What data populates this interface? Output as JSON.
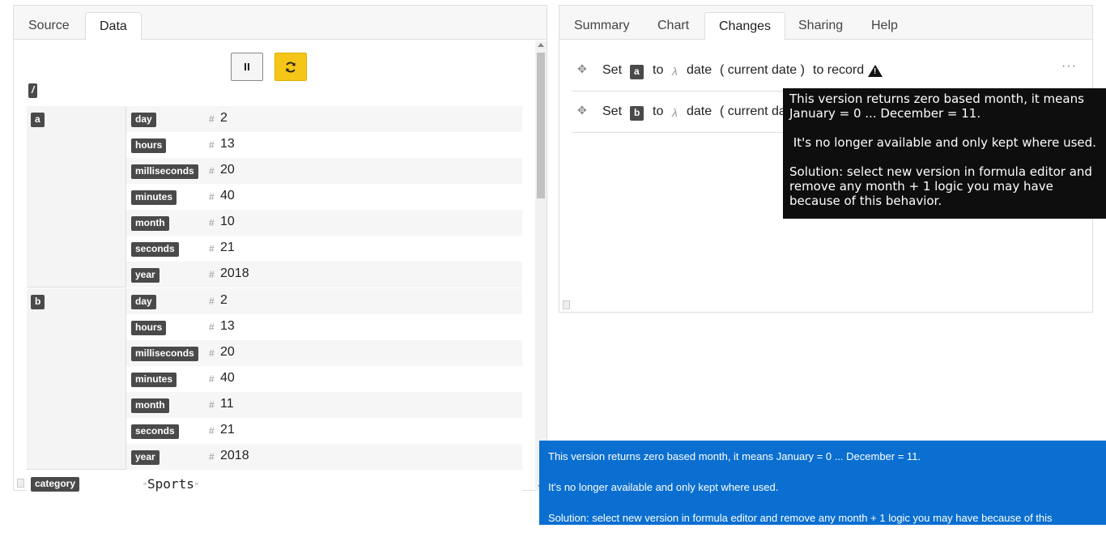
{
  "left_tabs": [
    "Source",
    "Data"
  ],
  "right_tabs": [
    "Summary",
    "Chart",
    "Changes",
    "Sharing",
    "Help"
  ],
  "data_view": {
    "root_label": "/",
    "group_a": {
      "key": "a",
      "rows": [
        {
          "key": "day",
          "value": "2"
        },
        {
          "key": "hours",
          "value": "13"
        },
        {
          "key": "milliseconds",
          "value": "20"
        },
        {
          "key": "minutes",
          "value": "40"
        },
        {
          "key": "month",
          "value": "10"
        },
        {
          "key": "seconds",
          "value": "21"
        },
        {
          "key": "year",
          "value": "2018"
        }
      ]
    },
    "group_b": {
      "key": "b",
      "rows": [
        {
          "key": "day",
          "value": "2"
        },
        {
          "key": "hours",
          "value": "13"
        },
        {
          "key": "milliseconds",
          "value": "20"
        },
        {
          "key": "minutes",
          "value": "40"
        },
        {
          "key": "month",
          "value": "11"
        },
        {
          "key": "seconds",
          "value": "21"
        },
        {
          "key": "year",
          "value": "2018"
        }
      ]
    },
    "type_mark": "#",
    "category": {
      "key": "category",
      "value": "Sports",
      "quote": "\""
    }
  },
  "changes": [
    {
      "verb": "Set",
      "field": "a",
      "to": "to",
      "lambda": "λ",
      "func": "date",
      "arg": "( current date )",
      "target": "to record"
    },
    {
      "verb": "Set",
      "field": "b",
      "to": "to",
      "lambda": "λ",
      "func": "date",
      "arg": "( current da"
    }
  ],
  "more_label": "···",
  "tooltip": {
    "line1": "This version returns zero based month, it means January = 0 ... December = 11.",
    "line2": " It's no longer available and only kept where used.",
    "line3": "Solution: select new version in formula editor and remove any month + 1 logic you may have because of this behavior."
  },
  "notice": {
    "line1": "This version returns zero based month, it means January = 0 ... December = 11.",
    "line2": "It's no longer available and only kept where used.",
    "line3": "Solution: select new version in formula editor and remove any month + 1 logic you may have because of this behavior."
  },
  "colors": {
    "accent_yellow": "#f5c518",
    "notice_blue": "#0a6fd1",
    "tag_dark": "#4a4a4a"
  }
}
